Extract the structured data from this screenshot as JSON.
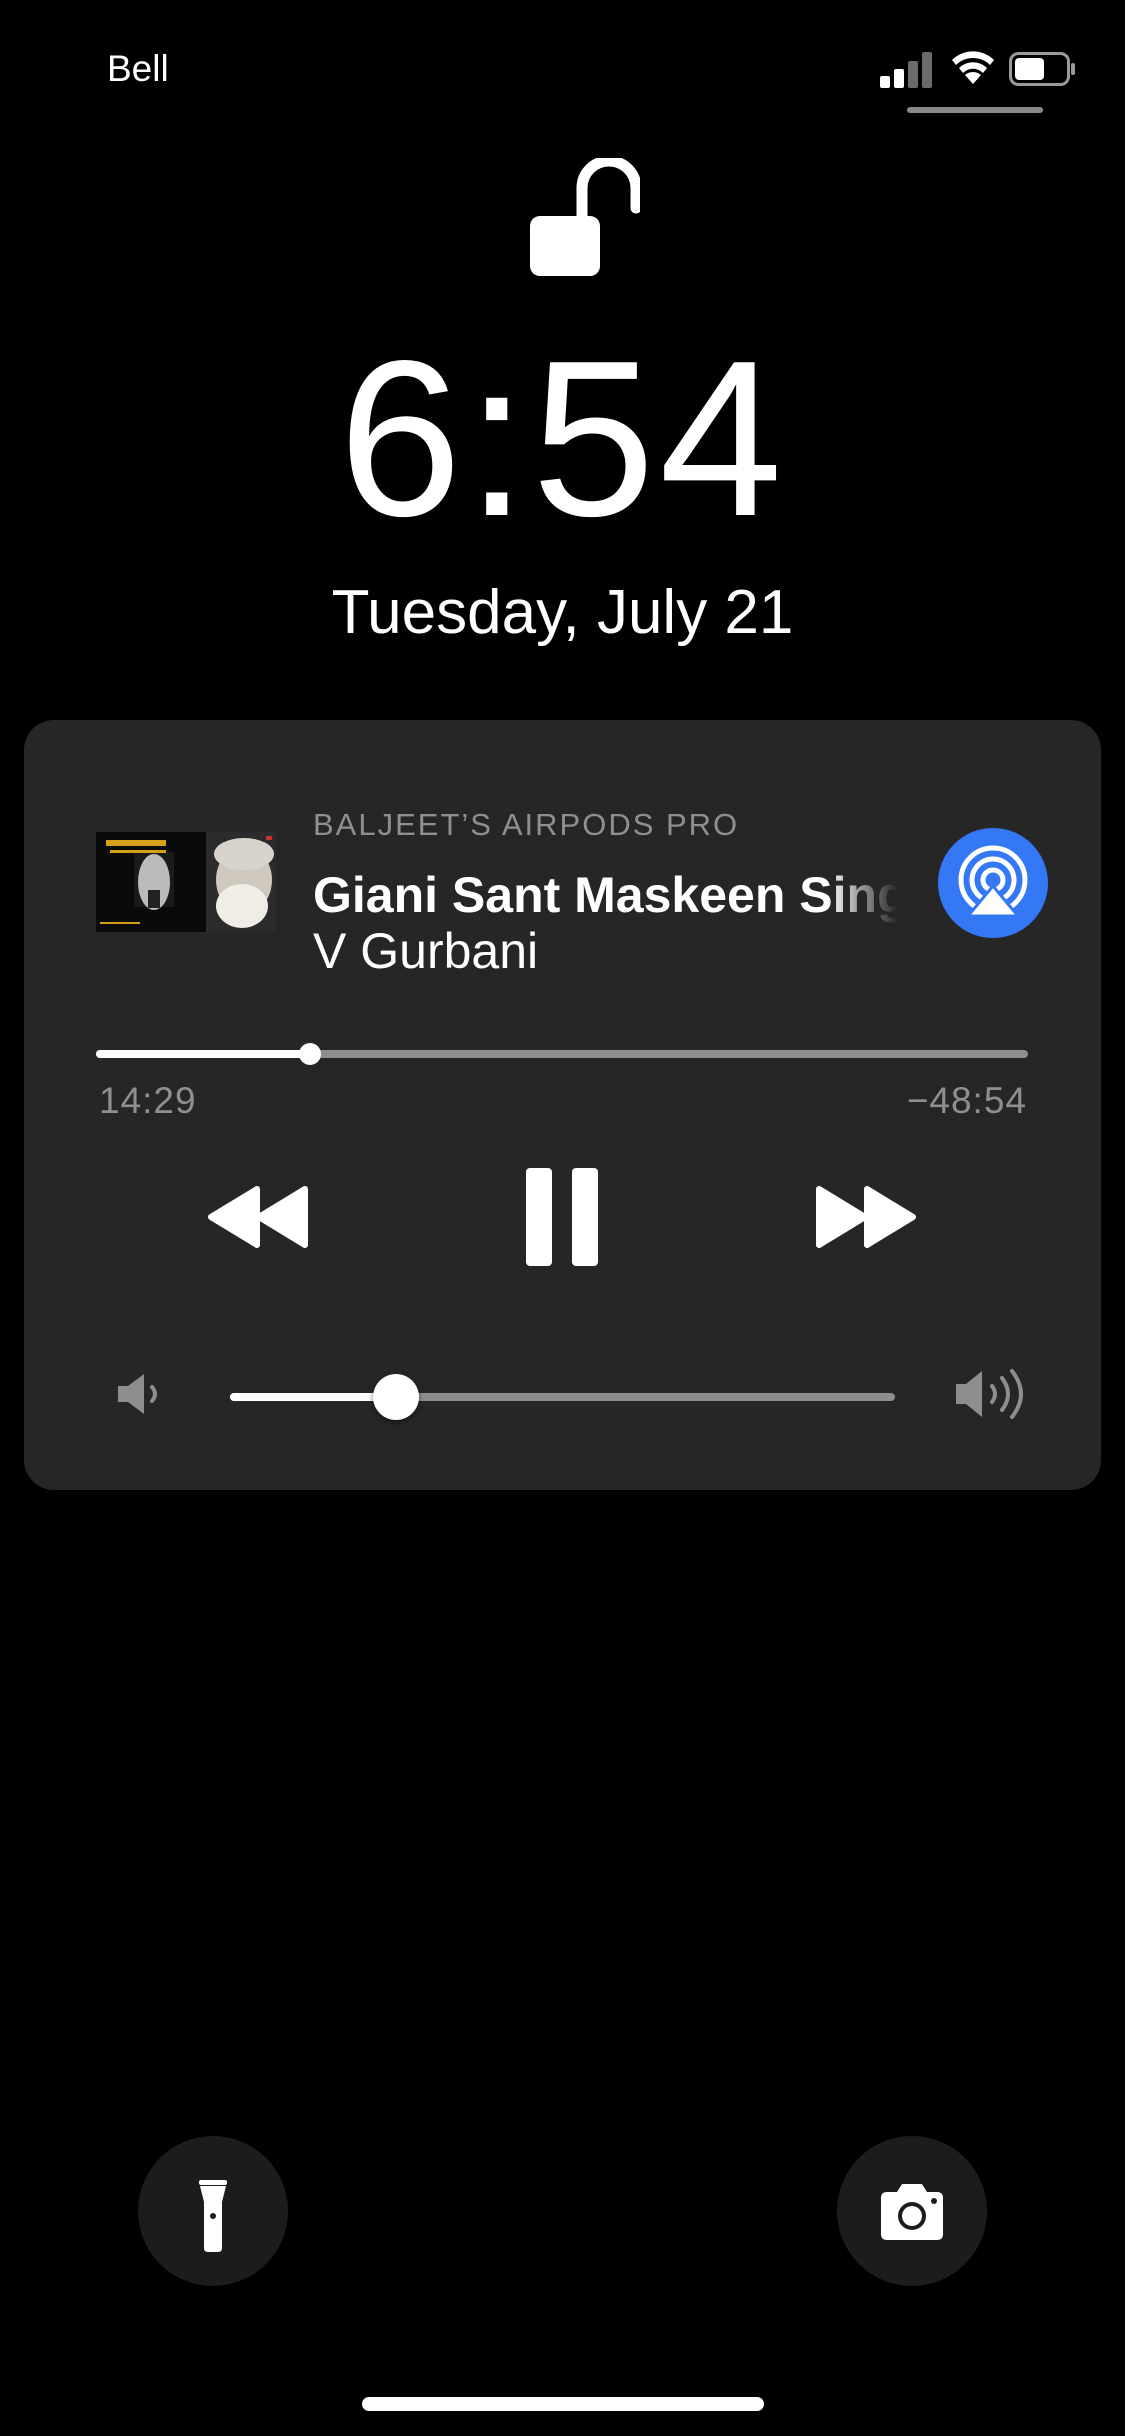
{
  "status": {
    "carrier": "Bell",
    "signal_bars": 4,
    "signal_bars_filled": 2,
    "battery_level": 0.6
  },
  "lock": {
    "icon": "lock-open-icon"
  },
  "clock": {
    "time": "6:54",
    "date": "Tuesday, July 21"
  },
  "now_playing": {
    "device": "BALJEET’S AIRPODS PRO",
    "title": "Giani Sant Maskeen Singh",
    "artist": "V Gurbani",
    "elapsed": "14:29",
    "remaining": "−48:54",
    "progress": 0.23,
    "volume": 0.25,
    "airplay_color": "#3478f6",
    "icons": {
      "rewind": "rewind-icon",
      "pause": "pause-icon",
      "fast_forward": "fast-forward-icon",
      "volume_low": "volume-low-icon",
      "volume_high": "volume-high-icon",
      "airplay": "airplay-icon"
    }
  },
  "bottom": {
    "left_icon": "flashlight-icon",
    "right_icon": "camera-icon"
  }
}
